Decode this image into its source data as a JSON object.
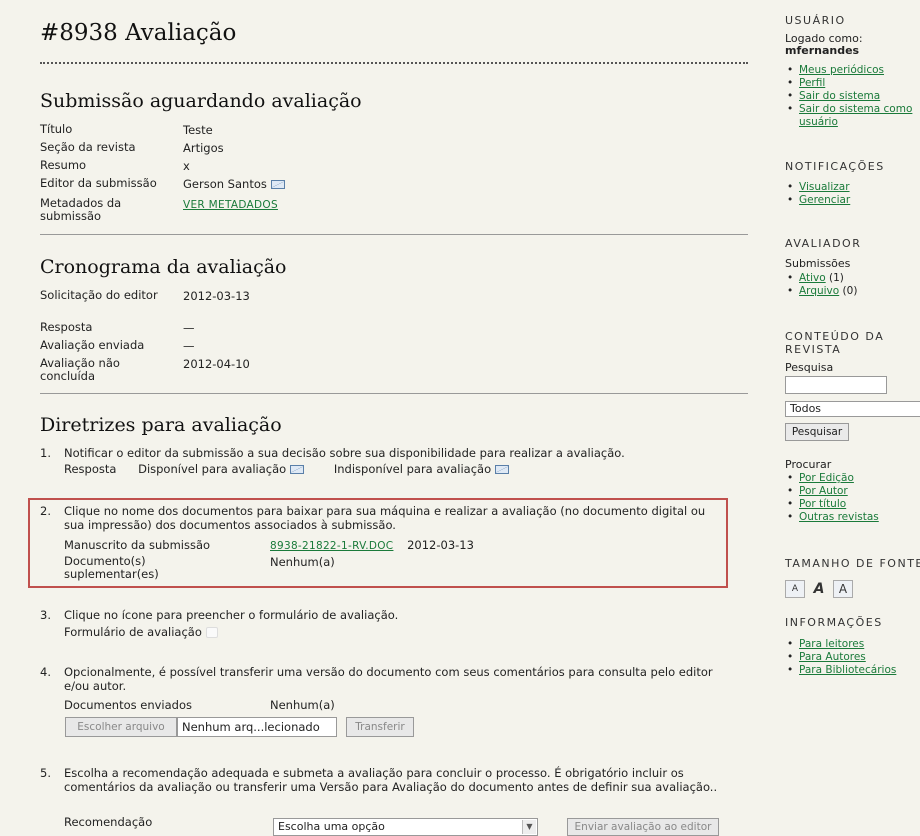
{
  "header": {
    "title": "#8938 Avaliação"
  },
  "submission": {
    "title": "Submissão aguardando avaliação",
    "rows": [
      {
        "label": "Título",
        "value": "Teste"
      },
      {
        "label": "Seção da revista",
        "value": "Artigos"
      },
      {
        "label": "Resumo",
        "value": "x"
      },
      {
        "label": "Editor da submissão",
        "value": "Gerson Santos"
      },
      {
        "label": "Metadados da submissão",
        "value": "VER METADADOS"
      }
    ]
  },
  "schedule": {
    "title": "Cronograma da avaliação",
    "rows": [
      {
        "label": "Solicitação do editor",
        "value": "2012-03-13"
      },
      {
        "label": "Resposta",
        "value": "—"
      },
      {
        "label": "Avaliação enviada",
        "value": "—"
      },
      {
        "label": "Avaliação não concluída",
        "value": "2012-04-10"
      }
    ]
  },
  "guidelines": {
    "title": "Diretrizes para avaliação",
    "step1": {
      "num": "1.",
      "text": "Notificar o editor da submissão a sua decisão sobre sua disponibilidade para realizar a avaliação.",
      "response_label": "Resposta",
      "available": "Disponível para avaliação",
      "unavailable": "Indisponível para avaliação"
    },
    "step2": {
      "num": "2.",
      "text": "Clique no nome dos documentos para baixar para sua máquina e realizar a avaliação (no documento digital ou sua impressão) dos documentos associados à submissão.",
      "manuscript_label": "Manuscrito da submissão",
      "manuscript_file": "8938-21822-1-RV.DOC",
      "manuscript_date": "2012-03-13",
      "supp_label": "Documento(s) suplementar(es)",
      "supp_value": "Nenhum(a)"
    },
    "step3": {
      "num": "3.",
      "text": "Clique no ícone para preencher o formulário de avaliação.",
      "form_label": "Formulário de avaliação"
    },
    "step4": {
      "num": "4.",
      "text": "Opcionalmente, é possível transferir uma versão do documento com seus comentários para consulta pelo editor e/ou autor.",
      "docs_label": "Documentos enviados",
      "docs_value": "Nenhum(a)",
      "choose_file": "Escolher arquivo",
      "file_name": "Nenhum arq...lecionado",
      "upload": "Transferir"
    },
    "step5": {
      "num": "5.",
      "text": "Escolha a recomendação adequada e submeta a avaliação para concluir o processo. É obrigatório incluir os comentários da avaliação ou transferir uma Versão para Avaliação do documento antes de definir sua avaliação..",
      "rec_label": "Recomendação",
      "rec_select": "Escolha uma opção",
      "send": "Enviar avaliação ao editor"
    }
  },
  "sidebar": {
    "user_title": "USUÁRIO",
    "logged_as": "Logado como:",
    "username": "mfernandes",
    "user_links": [
      "Meus periódicos",
      "Perfil",
      "Sair do sistema",
      "Sair do sistema como usuário"
    ],
    "notif_title": "NOTIFICAÇÕES",
    "notif_links": [
      "Visualizar",
      "Gerenciar"
    ],
    "reviewer_title": "AVALIADOR",
    "submissions_label": "Submissões",
    "active": "Ativo",
    "active_count": "(1)",
    "archive": "Arquivo",
    "archive_count": "(0)",
    "content_title": "CONTEÚDO DA REVISTA",
    "search_label": "Pesquisa",
    "search_scope": "Todos",
    "search_button": "Pesquisar",
    "browse_label": "Procurar",
    "browse_links": [
      "Por Edição",
      "Por Autor",
      "Por título",
      "Outras revistas"
    ],
    "font_title": "TAMANHO DE FONTE",
    "font_small": "A",
    "font_medium": "A",
    "font_large": "A",
    "info_title": "INFORMAÇÕES",
    "info_links": [
      "Para leitores",
      "Para Autores",
      "Para Bibliotecários"
    ]
  }
}
